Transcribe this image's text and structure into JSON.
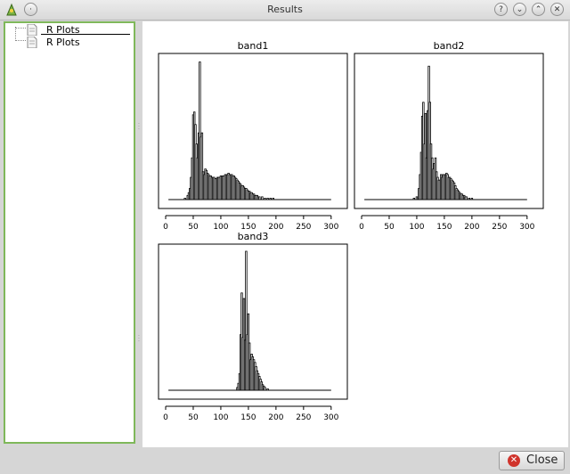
{
  "window": {
    "title": "Results",
    "buttons": [
      "?",
      "⌄",
      "⌃",
      "✕"
    ]
  },
  "tree": {
    "items": [
      {
        "label": "R Plots"
      },
      {
        "label": "R Plots"
      }
    ]
  },
  "footer": {
    "close_label": "Close"
  },
  "chart_data": [
    {
      "type": "bar",
      "title": "band1",
      "xlim": [
        0,
        310
      ],
      "xticks": [
        0,
        50,
        100,
        150,
        200,
        250,
        300
      ],
      "ymax": 100,
      "x": [
        5,
        10,
        15,
        20,
        25,
        30,
        35,
        40,
        42,
        44,
        46,
        48,
        50,
        52,
        54,
        56,
        58,
        60,
        62,
        64,
        66,
        68,
        70,
        72,
        74,
        76,
        78,
        80,
        82,
        84,
        86,
        88,
        90,
        92,
        94,
        96,
        98,
        100,
        102,
        104,
        106,
        108,
        110,
        112,
        114,
        116,
        118,
        120,
        122,
        124,
        126,
        128,
        130,
        132,
        134,
        136,
        138,
        140,
        142,
        144,
        146,
        148,
        150,
        152,
        154,
        156,
        158,
        160,
        162,
        164,
        166,
        168,
        170,
        175,
        180,
        185,
        190,
        195,
        200,
        210,
        220,
        230,
        240,
        250,
        260,
        270,
        280,
        290,
        300
      ],
      "values": [
        0,
        0,
        0,
        0,
        0,
        0,
        1,
        3,
        5,
        8,
        16,
        30,
        61,
        63,
        54,
        40,
        30,
        48,
        99,
        45,
        48,
        20,
        18,
        22,
        21,
        19,
        18,
        17,
        17,
        16,
        16,
        16,
        15,
        15,
        16,
        16,
        16,
        17,
        17,
        17,
        17,
        18,
        18,
        18,
        19,
        18,
        18,
        18,
        17,
        17,
        16,
        15,
        14,
        13,
        12,
        11,
        10,
        10,
        9,
        8,
        8,
        7,
        6,
        6,
        5,
        5,
        4,
        4,
        3,
        3,
        3,
        2,
        2,
        2,
        1,
        1,
        1,
        1,
        0,
        0,
        0,
        0,
        0,
        0,
        0,
        0,
        0,
        0,
        0
      ],
      "color": "#000000"
    },
    {
      "type": "bar",
      "title": "band2",
      "xlim": [
        0,
        310
      ],
      "xticks": [
        0,
        50,
        100,
        150,
        200,
        250,
        300
      ],
      "ymax": 100,
      "x": [
        5,
        20,
        40,
        60,
        80,
        90,
        95,
        100,
        104,
        106,
        108,
        110,
        112,
        114,
        116,
        118,
        120,
        122,
        124,
        126,
        128,
        130,
        132,
        134,
        136,
        138,
        140,
        142,
        144,
        146,
        148,
        150,
        152,
        154,
        156,
        158,
        160,
        162,
        164,
        166,
        168,
        170,
        172,
        174,
        176,
        178,
        180,
        182,
        184,
        186,
        188,
        190,
        195,
        200,
        210,
        220,
        240,
        260,
        280,
        300
      ],
      "values": [
        0,
        0,
        0,
        0,
        0,
        0,
        1,
        2,
        8,
        18,
        34,
        60,
        70,
        40,
        62,
        30,
        64,
        96,
        70,
        40,
        30,
        22,
        26,
        30,
        20,
        16,
        14,
        14,
        18,
        16,
        18,
        18,
        18,
        19,
        18,
        16,
        16,
        15,
        14,
        13,
        12,
        10,
        8,
        7,
        6,
        5,
        4,
        4,
        3,
        3,
        2,
        2,
        1,
        1,
        0,
        0,
        0,
        0,
        0,
        0
      ],
      "color": "#000000"
    },
    {
      "type": "bar",
      "title": "band3",
      "xlim": [
        0,
        310
      ],
      "xticks": [
        0,
        50,
        100,
        150,
        200,
        250,
        300
      ],
      "ymax": 100,
      "x": [
        5,
        50,
        100,
        125,
        130,
        132,
        134,
        136,
        138,
        140,
        142,
        144,
        146,
        148,
        150,
        152,
        154,
        156,
        158,
        160,
        162,
        164,
        166,
        168,
        170,
        172,
        174,
        176,
        178,
        180,
        185,
        190,
        200,
        250,
        300
      ],
      "values": [
        0,
        0,
        0,
        0,
        2,
        5,
        12,
        40,
        70,
        38,
        66,
        36,
        100,
        40,
        55,
        34,
        22,
        26,
        24,
        22,
        20,
        17,
        14,
        12,
        10,
        8,
        6,
        4,
        3,
        2,
        1,
        0,
        0,
        0,
        0
      ],
      "color": "#000000"
    }
  ]
}
